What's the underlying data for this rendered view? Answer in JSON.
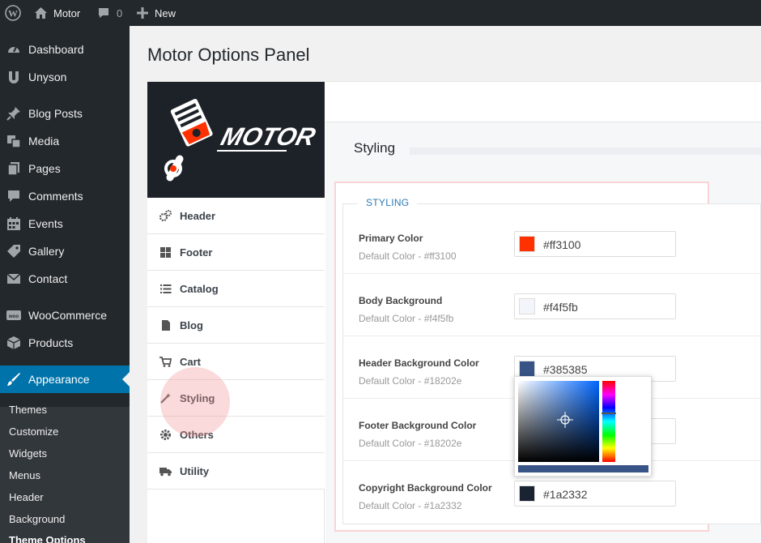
{
  "admin_bar": {
    "site_name": "Motor",
    "comments_count": "0",
    "new_label": "New",
    "icons": [
      "wordpress-icon",
      "home-icon",
      "comment-icon",
      "plus-icon"
    ]
  },
  "sidebar": {
    "items": [
      {
        "label": "Dashboard",
        "icon": "dashboard-icon"
      },
      {
        "label": "Unyson",
        "icon": "unyson-icon"
      },
      {
        "label": "Blog Posts",
        "icon": "pin-icon"
      },
      {
        "label": "Media",
        "icon": "media-icon"
      },
      {
        "label": "Pages",
        "icon": "pages-icon"
      },
      {
        "label": "Comments",
        "icon": "comments-icon"
      },
      {
        "label": "Events",
        "icon": "calendar-icon"
      },
      {
        "label": "Gallery",
        "icon": "tag-icon"
      },
      {
        "label": "Contact",
        "icon": "mail-icon"
      },
      {
        "label": "WooCommerce",
        "icon": "woocommerce-icon"
      },
      {
        "label": "Products",
        "icon": "box-icon"
      },
      {
        "label": "Appearance",
        "icon": "brush-icon"
      }
    ],
    "submenu": [
      "Themes",
      "Customize",
      "Widgets",
      "Menus",
      "Header",
      "Background",
      "Theme Options"
    ]
  },
  "page": {
    "title": "Motor Options Panel"
  },
  "logo": {
    "text": "MOTOR"
  },
  "options_nav": [
    {
      "label": "Header",
      "icon": "gears-icon"
    },
    {
      "label": "Footer",
      "icon": "grid-icon"
    },
    {
      "label": "Catalog",
      "icon": "list-icon"
    },
    {
      "label": "Blog",
      "icon": "document-icon"
    },
    {
      "label": "Cart",
      "icon": "cart-icon"
    },
    {
      "label": "Styling",
      "icon": "magic-wand-icon"
    },
    {
      "label": "Others",
      "icon": "gear-icon"
    },
    {
      "label": "Utility",
      "icon": "truck-icon"
    }
  ],
  "section": {
    "heading": "Styling",
    "legend": "STYLING"
  },
  "color_rows": [
    {
      "label": "Primary Color",
      "desc": "Default Color - #ff3100",
      "value": "#ff3100",
      "swatch": "#ff3100"
    },
    {
      "label": "Body Background",
      "desc": "Default Color - #f4f5fb",
      "value": "#f4f5fb",
      "swatch": "#f4f5fb"
    },
    {
      "label": "Header Background Color",
      "desc": "Default Color - #18202e",
      "value": "#385385",
      "swatch": "#385385"
    },
    {
      "label": "Footer Background Color",
      "desc": "Default Color - #18202e",
      "value": "",
      "swatch": "#18202e"
    },
    {
      "label": "Copyright Background Color",
      "desc": "Default Color - #1a2332",
      "value": "#1a2332",
      "swatch": "#1a2332"
    }
  ],
  "colors": {
    "admin_dark": "#23282d",
    "admin_accent": "#0073aa",
    "legend_blue": "#2a79b7",
    "picker_selected": "#385385"
  }
}
